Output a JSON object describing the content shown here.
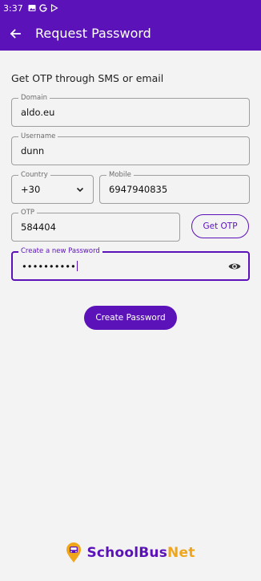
{
  "status_bar": {
    "time": "3:37",
    "icons": [
      "image-icon",
      "google-icon",
      "play-store-icon"
    ]
  },
  "app_bar": {
    "title": "Request Password",
    "back_icon": "arrow-left-icon"
  },
  "form": {
    "subtitle": "Get OTP through SMS or email",
    "domain": {
      "label": "Domain",
      "value": "aldo.eu"
    },
    "username": {
      "label": "Username",
      "value": "dunn"
    },
    "country": {
      "label": "Country",
      "value": "+30",
      "icon": "chevron-down-icon"
    },
    "mobile": {
      "label": "Mobile",
      "value": "6947940835"
    },
    "otp": {
      "label": "OTP",
      "value": "584404"
    },
    "get_otp_label": "Get OTP",
    "new_password": {
      "label": "Create a new Password",
      "value": "••••••••••",
      "icon": "eye-icon"
    },
    "create_label": "Create Password"
  },
  "brand": {
    "part1": "SchoolBus",
    "part2": "Net"
  },
  "colors": {
    "primary": "#5b12b8",
    "accent": "#f0a61a",
    "background": "#f3f3f3"
  }
}
